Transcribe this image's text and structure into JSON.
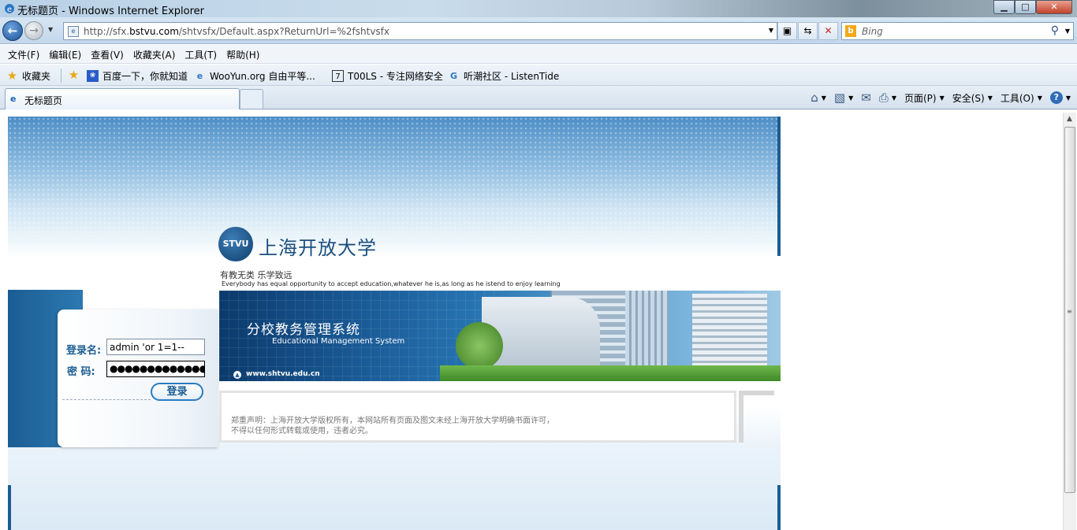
{
  "window": {
    "title": "无标题页 - Windows Internet Explorer",
    "buttons": {
      "minimize": "▁",
      "maximize": "□",
      "close": "✕"
    }
  },
  "nav": {
    "url_prefix": "http://sfx.",
    "url_host": "bstvu.com",
    "url_path": "/shtvsfx/Default.aspx?ReturnUrl=%2fshtvsfx",
    "search_placeholder": "Bing"
  },
  "menubar": [
    "文件(F)",
    "编辑(E)",
    "查看(V)",
    "收藏夹(A)",
    "工具(T)",
    "帮助(H)"
  ],
  "favorites": {
    "main": "收藏夹",
    "items": [
      "百度一下，你就知道",
      "WooYun.org  自由平等...",
      "T00LS - 专注网络安全",
      "听潮社区 - ListenTide"
    ]
  },
  "tab": {
    "label": "无标题页"
  },
  "commands": {
    "page": "页面(P)",
    "safety": "安全(S)",
    "tools": "工具(O)"
  },
  "page": {
    "logo_text": "STVU",
    "school_name": "上海开放大学",
    "motto": "有教无类    乐学致远",
    "motto_en": "Everybody has equal opportunity to accept education,whatever he is,as long as he istend to enjoy learning",
    "system_cn": "分校教务管理系统",
    "system_en": "Educational Management System",
    "site_url": "www.shtvu.edu.cn",
    "login": {
      "username_label": "登录名:",
      "username_value": "admin 'or 1=1--",
      "password_label": "密    码:",
      "password_value": "●●●●●●●●●●●●●●●●",
      "button_label": "登录"
    },
    "notice": [
      "郑重声明：上海开放大学版权所有，本网站所有页面及图文未经上海开放大学明确书面许可，",
      "不得以任何形式转载或使用，违者必究。"
    ]
  },
  "colors": {
    "brand_blue": "#1b5d93",
    "ie_chrome": "#d6e5f3"
  },
  "icons": [
    "ie-icon",
    "back-icon",
    "forward-icon",
    "refresh-icon",
    "stop-icon",
    "search-icon",
    "star-icon",
    "home-icon",
    "rss-icon",
    "mail-icon",
    "print-icon",
    "help-icon"
  ]
}
